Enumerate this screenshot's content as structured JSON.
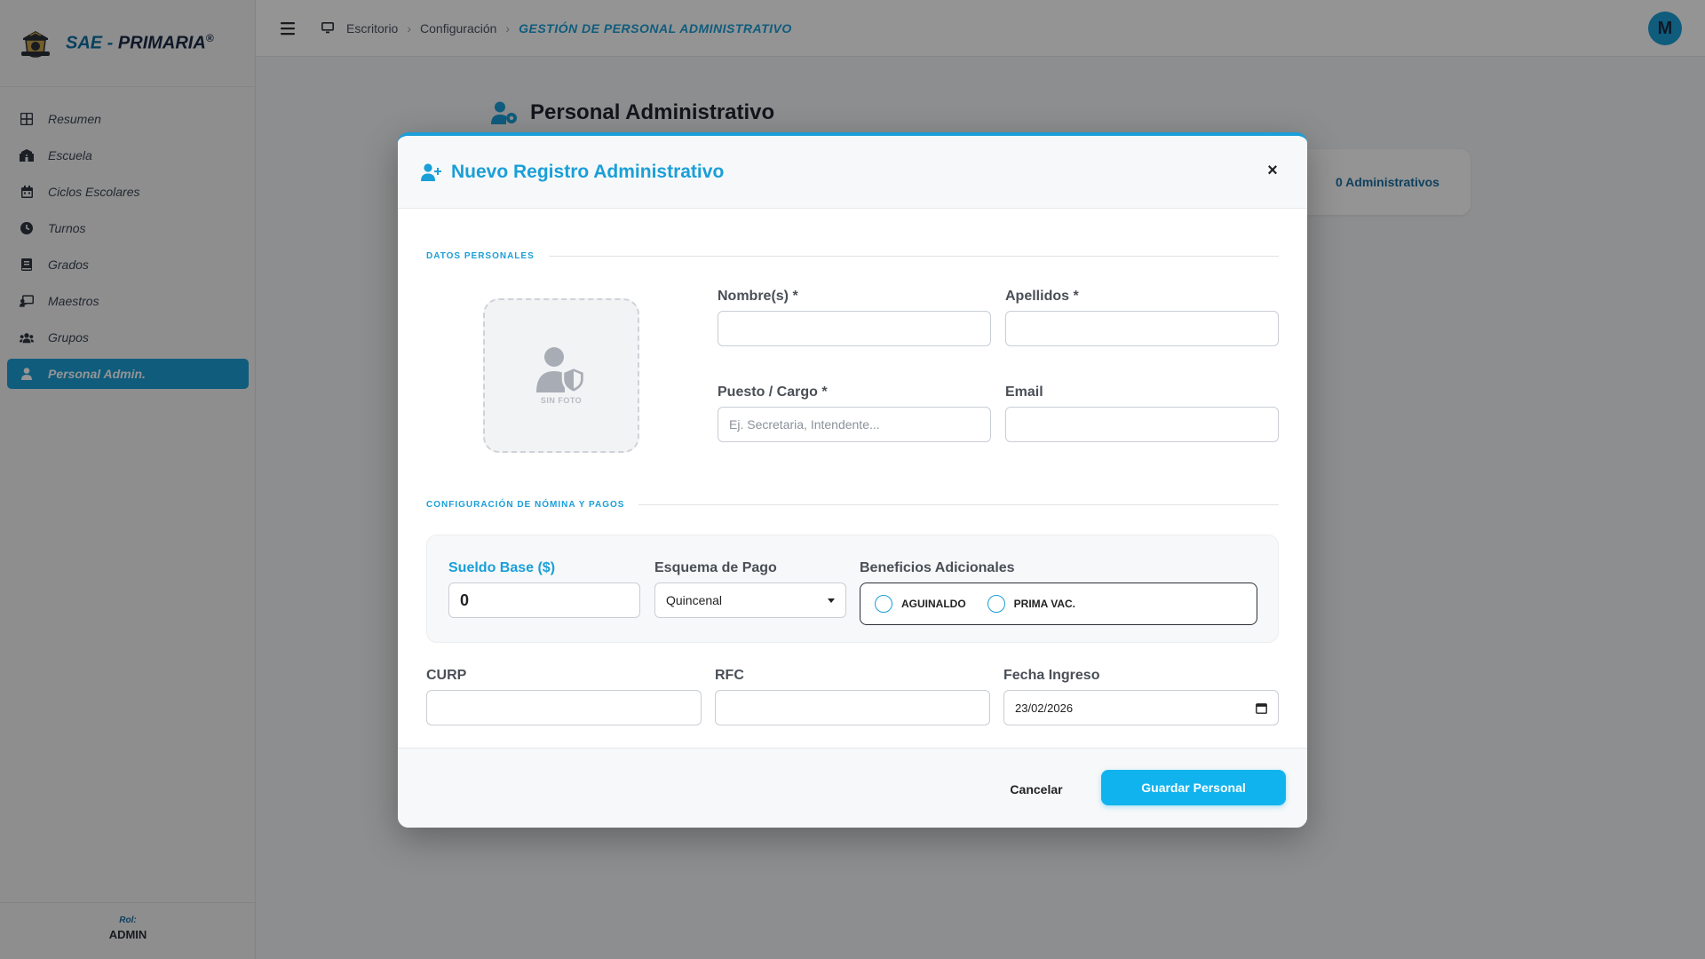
{
  "brand": {
    "prefix": "SAE -",
    "name": "PRIMARIA",
    "mark": "®"
  },
  "sidebar": {
    "items": [
      {
        "label": "Resumen",
        "icon": "grid-icon",
        "active": false
      },
      {
        "label": "Escuela",
        "icon": "school-icon",
        "active": false
      },
      {
        "label": "Ciclos Escolares",
        "icon": "calendar-icon",
        "active": false
      },
      {
        "label": "Turnos",
        "icon": "clock-icon",
        "active": false
      },
      {
        "label": "Grados",
        "icon": "book-icon",
        "active": false
      },
      {
        "label": "Maestros",
        "icon": "chalkboard-teacher-icon",
        "active": false
      },
      {
        "label": "Grupos",
        "icon": "users-icon",
        "active": false
      },
      {
        "label": "Personal Admin.",
        "icon": "user-icon",
        "active": true
      }
    ],
    "role": {
      "label": "Rol:",
      "value": "ADMIN"
    }
  },
  "topbar": {
    "breadcrumbs": [
      "Escritorio",
      "Configuración",
      "GESTIÓN DE PERSONAL ADMINISTRATIVO"
    ],
    "avatar_initial": "M"
  },
  "page": {
    "title": "Personal Administrativo",
    "stat": "0 Administrativos"
  },
  "modal": {
    "title": "Nuevo Registro Administrativo",
    "section_personal": "DATOS PERSONALES",
    "photo_caption": "SIN FOTO",
    "fields": {
      "nombre": {
        "label": "Nombre(s) *",
        "value": "",
        "placeholder": ""
      },
      "apellidos": {
        "label": "Apellidos *",
        "value": "",
        "placeholder": ""
      },
      "puesto": {
        "label": "Puesto / Cargo *",
        "value": "",
        "placeholder": "Ej. Secretaria, Intendente..."
      },
      "email": {
        "label": "Email",
        "value": "",
        "placeholder": ""
      }
    },
    "section_payroll": "CONFIGURACIÓN DE NÓMINA Y PAGOS",
    "payroll": {
      "salary": {
        "label": "Sueldo Base ($)",
        "value": "0"
      },
      "scheme": {
        "label": "Esquema de Pago",
        "selected": "Quincenal"
      },
      "benefits": {
        "label": "Beneficios Adicionales",
        "options": [
          "AGUINALDO",
          "PRIMA VAC."
        ]
      }
    },
    "ids": {
      "curp": {
        "label": "CURP",
        "value": ""
      },
      "rfc": {
        "label": "RFC",
        "value": ""
      },
      "fecha": {
        "label": "Fecha Ingreso",
        "value": "23/02/2026"
      }
    },
    "buttons": {
      "cancel": "Cancelar",
      "save": "Guardar Personal"
    }
  },
  "colors": {
    "accent": "#1a9fd8",
    "save_button": "#11b3ee",
    "brand_dark": "#1a2a44"
  }
}
